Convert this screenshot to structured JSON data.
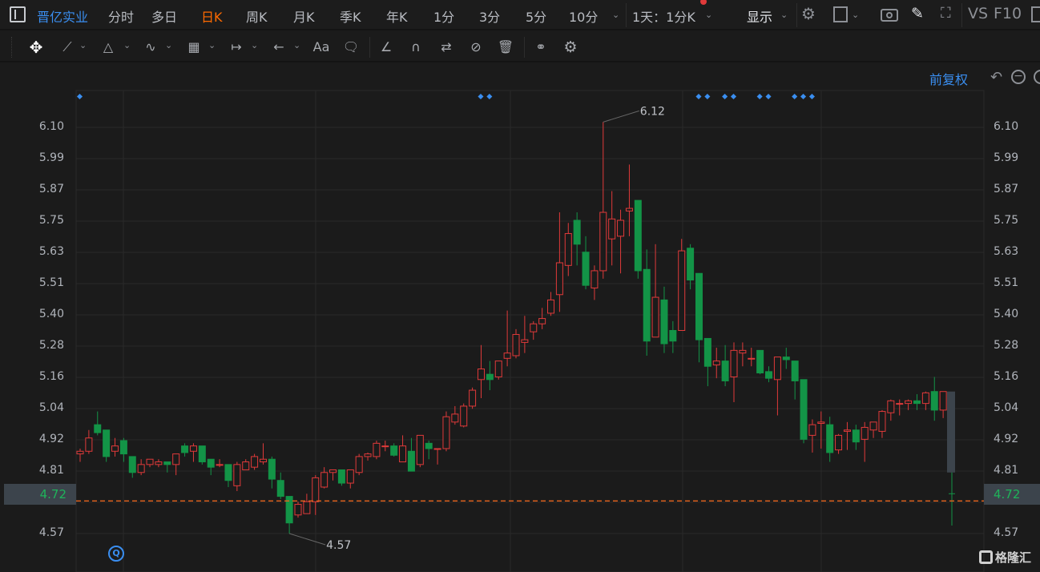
{
  "topbar": {
    "stock_name": "晋亿实业",
    "periods": [
      "分时",
      "多日",
      "日K",
      "周K",
      "月K",
      "季K",
      "年K",
      "1分",
      "3分",
      "5分",
      "10分"
    ],
    "active_period": "日K",
    "range_select": "1天：1分K",
    "display_label": "显示",
    "vs_label": "VS",
    "f10_label": "F10"
  },
  "toolbar": {
    "icons": [
      "move-icon",
      "line-icon",
      "polygon-icon",
      "wave-icon",
      "fibonacci-icon",
      "measure-icon",
      "arrow-icon",
      "text-icon",
      "comment-icon",
      "angle-icon",
      "magnet-icon",
      "sync-icon",
      "hide-icon",
      "trash-icon",
      "compare-icon",
      "settings-icon"
    ],
    "text_tool_label": "Aa"
  },
  "chart_header": {
    "adjust_label": "前复权"
  },
  "colors": {
    "up": "#e03a3a",
    "down": "#139447",
    "accent": "#3a8ef0",
    "active_tab": "#ff6a00",
    "price_line": "#e8641c"
  },
  "watermark": "格隆汇",
  "current_price": "4.72",
  "chart_data": {
    "type": "candlestick",
    "ylim": [
      4.57,
      6.1
    ],
    "y_ticks": [
      "6.10",
      "5.99",
      "5.87",
      "5.75",
      "5.63",
      "5.51",
      "5.40",
      "5.28",
      "5.16",
      "5.04",
      "4.92",
      "4.81",
      "4.69",
      "4.57"
    ],
    "grid": true,
    "annotations": [
      {
        "label": "6.12",
        "candle": 61,
        "value": 6.12
      },
      {
        "label": "4.57",
        "candle": 25,
        "value": 4.57
      }
    ],
    "event_marker_candles": [
      1,
      47,
      48,
      72,
      73,
      75,
      76,
      79,
      80,
      83,
      84,
      85
    ],
    "candles_ohlc": [
      [
        4.87,
        4.89,
        4.84,
        4.88
      ],
      [
        4.88,
        4.96,
        4.87,
        4.93
      ],
      [
        4.98,
        5.03,
        4.94,
        4.95
      ],
      [
        4.96,
        4.96,
        4.84,
        4.86
      ],
      [
        4.88,
        4.93,
        4.86,
        4.9
      ],
      [
        4.92,
        4.93,
        4.84,
        4.87
      ],
      [
        4.86,
        4.86,
        4.78,
        4.8
      ],
      [
        4.8,
        4.85,
        4.79,
        4.83
      ],
      [
        4.83,
        4.85,
        4.82,
        4.85
      ],
      [
        4.83,
        4.85,
        4.82,
        4.84
      ],
      [
        4.84,
        4.84,
        4.8,
        4.83
      ],
      [
        4.83,
        4.87,
        4.79,
        4.87
      ],
      [
        4.9,
        4.91,
        4.86,
        4.875
      ],
      [
        4.88,
        4.91,
        4.84,
        4.9
      ],
      [
        4.9,
        4.9,
        4.83,
        4.84
      ],
      [
        4.85,
        4.85,
        4.79,
        4.82
      ],
      [
        4.83,
        4.85,
        4.82,
        4.83
      ],
      [
        4.83,
        4.83,
        4.745,
        4.77
      ],
      [
        4.75,
        4.84,
        4.73,
        4.83
      ],
      [
        4.81,
        4.85,
        4.81,
        4.84
      ],
      [
        4.82,
        4.87,
        4.81,
        4.86
      ],
      [
        4.84,
        4.91,
        4.83,
        4.85
      ],
      [
        4.85,
        4.86,
        4.74,
        4.775
      ],
      [
        4.77,
        4.8,
        4.7,
        4.71
      ],
      [
        4.71,
        4.71,
        4.57,
        4.61
      ],
      [
        4.64,
        4.69,
        4.63,
        4.68
      ],
      [
        4.645,
        4.72,
        4.645,
        4.69
      ],
      [
        4.69,
        4.79,
        4.64,
        4.78
      ],
      [
        4.745,
        4.82,
        4.74,
        4.8
      ],
      [
        4.8,
        4.81,
        4.77,
        4.81
      ],
      [
        4.81,
        4.81,
        4.75,
        4.76
      ],
      [
        4.76,
        4.81,
        4.74,
        4.81
      ],
      [
        4.8,
        4.87,
        4.79,
        4.86
      ],
      [
        4.86,
        4.875,
        4.845,
        4.87
      ],
      [
        4.86,
        4.92,
        4.85,
        4.91
      ],
      [
        4.9,
        4.92,
        4.88,
        4.9
      ],
      [
        4.9,
        4.91,
        4.86,
        4.865
      ],
      [
        4.84,
        4.94,
        4.84,
        4.9
      ],
      [
        4.88,
        4.93,
        4.805,
        4.805
      ],
      [
        4.83,
        4.94,
        4.82,
        4.94
      ],
      [
        4.91,
        4.92,
        4.85,
        4.89
      ],
      [
        4.89,
        4.89,
        4.83,
        4.89
      ],
      [
        4.89,
        5.03,
        4.88,
        5.01
      ],
      [
        4.99,
        5.05,
        4.98,
        5.02
      ],
      [
        4.975,
        5.06,
        4.97,
        5.05
      ],
      [
        5.05,
        5.12,
        5.04,
        5.11
      ],
      [
        5.15,
        5.28,
        5.08,
        5.19
      ],
      [
        5.17,
        5.22,
        5.11,
        5.15
      ],
      [
        5.16,
        5.22,
        5.15,
        5.22
      ],
      [
        5.23,
        5.41,
        5.2,
        5.25
      ],
      [
        5.24,
        5.34,
        5.23,
        5.32
      ],
      [
        5.29,
        5.39,
        5.25,
        5.3
      ],
      [
        5.33,
        5.37,
        5.3,
        5.36
      ],
      [
        5.36,
        5.42,
        5.34,
        5.38
      ],
      [
        5.4,
        5.48,
        5.39,
        5.45
      ],
      [
        5.47,
        5.78,
        5.405,
        5.59
      ],
      [
        5.58,
        5.74,
        5.54,
        5.7
      ],
      [
        5.75,
        5.78,
        5.58,
        5.66
      ],
      [
        5.63,
        5.69,
        5.49,
        5.505
      ],
      [
        5.495,
        5.58,
        5.45,
        5.56
      ],
      [
        5.56,
        6.12,
        5.53,
        5.78
      ],
      [
        5.68,
        5.86,
        5.58,
        5.755
      ],
      [
        5.69,
        5.79,
        5.55,
        5.75
      ],
      [
        5.785,
        5.96,
        5.69,
        5.795
      ],
      [
        5.825,
        5.825,
        5.53,
        5.56
      ],
      [
        5.565,
        5.64,
        5.24,
        5.295
      ],
      [
        5.31,
        5.66,
        5.31,
        5.46
      ],
      [
        5.45,
        5.5,
        5.25,
        5.285
      ],
      [
        5.335,
        5.37,
        5.25,
        5.295
      ],
      [
        5.335,
        5.68,
        5.335,
        5.635
      ],
      [
        5.645,
        5.66,
        5.49,
        5.525
      ],
      [
        5.55,
        5.55,
        5.215,
        5.3
      ],
      [
        5.305,
        5.305,
        5.125,
        5.2
      ],
      [
        5.205,
        5.27,
        5.155,
        5.22
      ],
      [
        5.22,
        5.28,
        5.125,
        5.145
      ],
      [
        5.16,
        5.29,
        5.065,
        5.26
      ],
      [
        5.25,
        5.29,
        5.2,
        5.26
      ],
      [
        5.23,
        5.27,
        5.2,
        5.23
      ],
      [
        5.26,
        5.26,
        5.17,
        5.175
      ],
      [
        5.18,
        5.2,
        5.14,
        5.155
      ],
      [
        5.15,
        5.235,
        5.015,
        5.235
      ],
      [
        5.235,
        5.27,
        5.19,
        5.225
      ],
      [
        5.22,
        5.22,
        5.075,
        5.145
      ],
      [
        5.15,
        5.15,
        4.91,
        4.925
      ],
      [
        4.94,
        5.0,
        4.875,
        4.98
      ],
      [
        4.985,
        5.03,
        4.89,
        4.99
      ],
      [
        4.98,
        5.01,
        4.84,
        4.875
      ],
      [
        4.885,
        4.945,
        4.87,
        4.94
      ],
      [
        4.955,
        4.99,
        4.885,
        4.96
      ],
      [
        4.96,
        4.98,
        4.885,
        4.915
      ],
      [
        4.925,
        4.99,
        4.84,
        4.97
      ],
      [
        4.96,
        4.99,
        4.93,
        4.99
      ],
      [
        4.955,
        5.035,
        4.93,
        5.03
      ],
      [
        5.025,
        5.075,
        4.995,
        5.07
      ],
      [
        5.06,
        5.075,
        5.015,
        5.06
      ],
      [
        5.06,
        5.075,
        5.035,
        5.07
      ],
      [
        5.07,
        5.095,
        5.035,
        5.06
      ],
      [
        5.06,
        5.105,
        5.035,
        5.1
      ],
      [
        5.105,
        5.16,
        4.995,
        5.035
      ],
      [
        5.035,
        5.105,
        5.005,
        5.105
      ],
      [
        4.8,
        4.8,
        4.6,
        4.72
      ]
    ]
  }
}
